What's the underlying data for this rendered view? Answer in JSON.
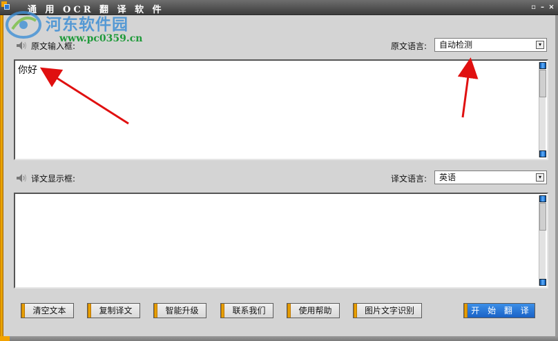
{
  "window": {
    "title": "通 用 OCR 翻 译 软 件",
    "controls": [
      "▫",
      "–",
      "×"
    ]
  },
  "watermark": {
    "site_name": "河东软件园",
    "url": "www.pc0359.cn"
  },
  "source": {
    "label": "原文输入框:",
    "lang_label": "原文语言:",
    "lang_value": "自动检测",
    "text": "你好"
  },
  "target": {
    "label": "译文显示框:",
    "lang_label": "译文语言:",
    "lang_value": "英语",
    "text": ""
  },
  "buttons": {
    "clear": "清空文本",
    "copy": "复制译文",
    "upgrade": "智能升级",
    "contact": "联系我们",
    "help": "使用帮助",
    "ocr": "图片文字识别",
    "translate": "开 始 翻 译"
  },
  "colors": {
    "accent_orange": "#f4a300",
    "primary_blue": "#1a62c6",
    "arrow_red": "#e01010"
  }
}
